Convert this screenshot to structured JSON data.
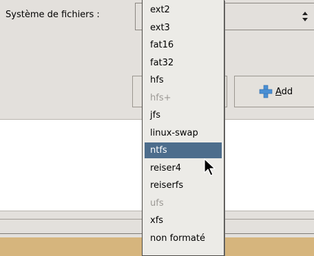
{
  "form": {
    "filesystem_label": "Système de fichiers :"
  },
  "buttons": {
    "add_mnemonic": "A",
    "add_rest": "dd"
  },
  "dropdown": {
    "options": [
      {
        "label": "ext2",
        "disabled": false,
        "selected": false
      },
      {
        "label": "ext3",
        "disabled": false,
        "selected": false
      },
      {
        "label": "fat16",
        "disabled": false,
        "selected": false
      },
      {
        "label": "fat32",
        "disabled": false,
        "selected": false
      },
      {
        "label": "hfs",
        "disabled": false,
        "selected": false
      },
      {
        "label": "hfs+",
        "disabled": true,
        "selected": false
      },
      {
        "label": "jfs",
        "disabled": false,
        "selected": false
      },
      {
        "label": "linux-swap",
        "disabled": false,
        "selected": false
      },
      {
        "label": "ntfs",
        "disabled": false,
        "selected": true
      },
      {
        "label": "reiser4",
        "disabled": false,
        "selected": false
      },
      {
        "label": "reiserfs",
        "disabled": false,
        "selected": false
      },
      {
        "label": "ufs",
        "disabled": true,
        "selected": false
      },
      {
        "label": "xfs",
        "disabled": false,
        "selected": false
      },
      {
        "label": "non formaté",
        "disabled": false,
        "selected": false
      }
    ]
  },
  "colors": {
    "selection": "#4d6d8c",
    "disabled_text": "#9b9894",
    "add_icon": "#4a8fd4",
    "bottom_bar": "#d6b57d"
  }
}
